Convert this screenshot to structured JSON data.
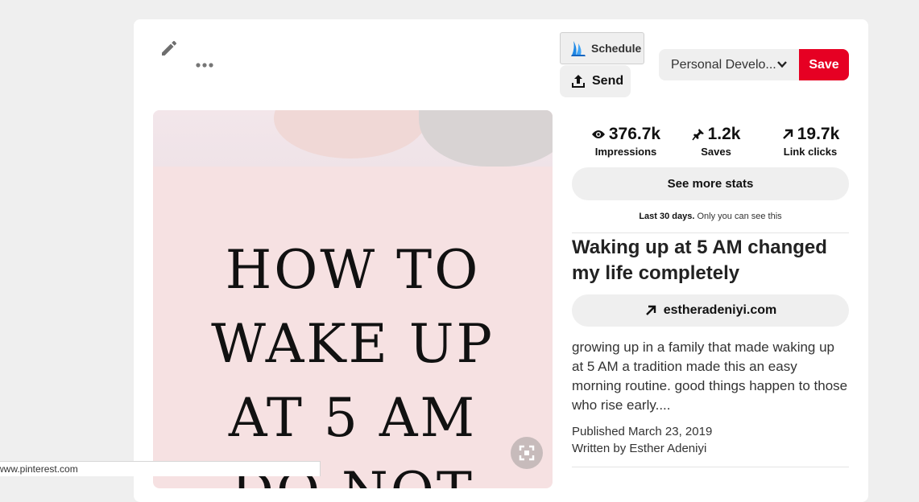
{
  "toolbar": {
    "edit_icon": "pencil-icon",
    "more_icon": "ellipsis-icon",
    "schedule_label": "Schedule",
    "send_label": "Send",
    "board_selected": "Personal Develo...",
    "save_label": "Save",
    "accent_color": "#e60023"
  },
  "pin_image": {
    "lines": [
      "HOW TO",
      "WAKE UP",
      "AT 5 AM",
      "DO NOT"
    ],
    "background": "#f6e1e2"
  },
  "stats": [
    {
      "icon": "eye-icon",
      "value": "376.7k",
      "label": "Impressions"
    },
    {
      "icon": "pin-icon",
      "value": "1.2k",
      "label": "Saves"
    },
    {
      "icon": "arrow-up-right-icon",
      "value": "19.7k",
      "label": "Link clicks"
    }
  ],
  "see_more_label": "See more stats",
  "stats_note": {
    "bold": "Last 30 days.",
    "rest": "Only you can see this"
  },
  "pin": {
    "title": "Waking up at 5 AM changed my life completely",
    "link": "estheradeniyi.com",
    "description": "growing up in a family that made waking up at 5 AM a tradition made this an easy morning routine. good things happen to those who rise early....",
    "published": "Published March 23, 2019",
    "written_by": "Written by Esther Adeniyi"
  },
  "statusbar": {
    "url": "www.pinterest.com"
  }
}
